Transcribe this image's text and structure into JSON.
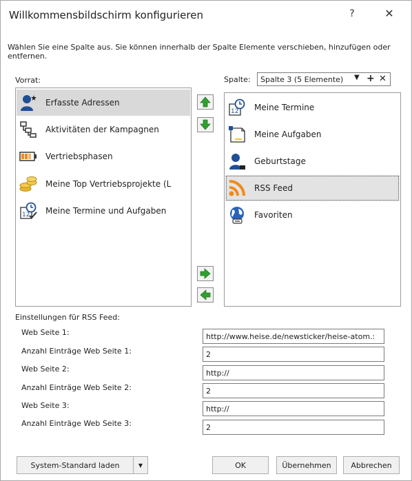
{
  "dialog": {
    "title": "Willkommensbildschirm konfigurieren",
    "help": "?",
    "close": "✕",
    "instruction": "Wählen Sie eine Spalte aus. Sie können innerhalb der Spalte Elemente verschieben, hinzufügen oder entfernen."
  },
  "vorrat": {
    "label": "Vorrat:",
    "items": [
      {
        "label": "Erfasste Adressen",
        "icon": "person-add-icon"
      },
      {
        "label": "Aktivitäten der Kampagnen",
        "icon": "flowchart-icon"
      },
      {
        "label": "Vertriebsphasen",
        "icon": "battery-icon"
      },
      {
        "label": "Meine Top Vertriebsprojekte (L",
        "icon": "coins-icon"
      },
      {
        "label": "Meine Termine und Aufgaben",
        "icon": "calendar-check-icon"
      }
    ]
  },
  "spalte": {
    "label": "Spalte:",
    "selected": "Spalte 3 (5 Elemente)",
    "items": [
      {
        "label": "Meine Termine",
        "icon": "calendar-clock-icon"
      },
      {
        "label": "Meine Aufgaben",
        "icon": "task-icon"
      },
      {
        "label": "Geburtstage",
        "icon": "person-icon"
      },
      {
        "label": "RSS Feed",
        "icon": "rss-icon"
      },
      {
        "label": "Favoriten",
        "icon": "globe-icon"
      }
    ]
  },
  "settings": {
    "header": "Einstellungen für RSS Feed:",
    "fields": [
      {
        "label": "Web Seite 1:",
        "value": "http://www.heise.de/newsticker/heise-atom.:"
      },
      {
        "label": "Anzahl Einträge Web Seite 1:",
        "value": "2"
      },
      {
        "label": "Web Seite 2:",
        "value": "http://"
      },
      {
        "label": "Anzahl Einträge Web Seite 2:",
        "value": "2"
      },
      {
        "label": "Web Seite 3:",
        "value": "http://"
      },
      {
        "label": "Anzahl Einträge Web Seite 3:",
        "value": "2"
      }
    ]
  },
  "buttons": {
    "system_default": "System-Standard laden",
    "ok": "OK",
    "apply": "Übernehmen",
    "cancel": "Abbrechen"
  },
  "colors": {
    "arrow_green": "#2fa02f",
    "rss_orange": "#f08a1c",
    "person_blue": "#1f4f96"
  }
}
